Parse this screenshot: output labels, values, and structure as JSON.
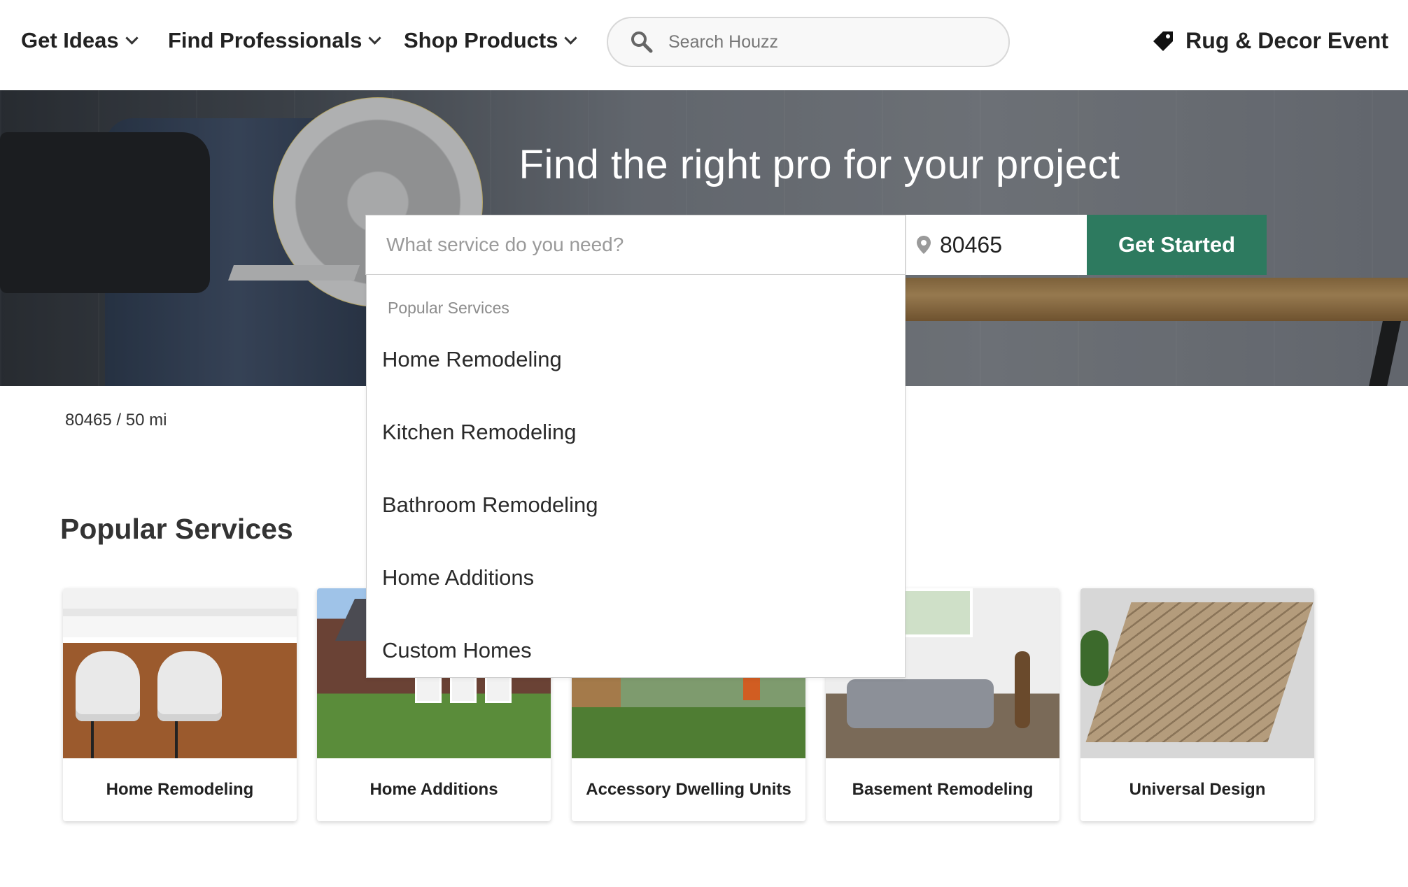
{
  "nav": {
    "items": [
      {
        "label": "Get Ideas"
      },
      {
        "label": "Find Professionals"
      },
      {
        "label": "Shop Products"
      }
    ],
    "search_placeholder": "Search Houzz",
    "promo_label": "Rug & Decor Event"
  },
  "hero": {
    "title": "Find the right pro for your project",
    "service_placeholder": "What service do you need?",
    "zip_value": "80465",
    "cta_label": "Get Started"
  },
  "dropdown": {
    "heading": "Popular Services",
    "items": [
      {
        "label": "Home Remodeling"
      },
      {
        "label": "Kitchen Remodeling"
      },
      {
        "label": "Bathroom Remodeling"
      },
      {
        "label": "Home Additions"
      },
      {
        "label": "Custom Homes"
      }
    ]
  },
  "location": "80465 / 50 mi",
  "popular": {
    "title": "Popular Services",
    "cards": [
      {
        "label": "Home Remodeling"
      },
      {
        "label": "Home Additions"
      },
      {
        "label": "Accessory Dwelling Units"
      },
      {
        "label": "Basement Remodeling"
      },
      {
        "label": "Universal Design"
      }
    ]
  },
  "colors": {
    "cta": "#2d7a5f",
    "text": "#222222"
  }
}
